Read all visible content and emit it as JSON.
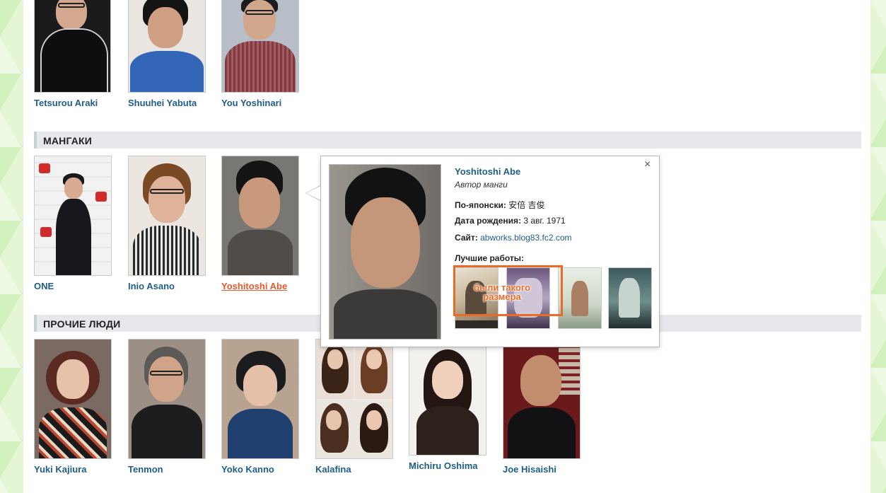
{
  "sections": {
    "mangaka_header": "МАНГАКИ",
    "others_header": "ПРОЧИЕ ЛЮДИ"
  },
  "top_people": [
    {
      "name": "Tetsurou Araki"
    },
    {
      "name": "Shuuhei Yabuta"
    },
    {
      "name": "You Yoshinari"
    }
  ],
  "mangaka": [
    {
      "name": "ONE"
    },
    {
      "name": "Inio Asano"
    },
    {
      "name": "Yoshitoshi Abe"
    }
  ],
  "others": [
    {
      "name": "Yuki Kajiura"
    },
    {
      "name": "Tenmon"
    },
    {
      "name": "Yoko Kanno"
    },
    {
      "name": "Kalafina"
    },
    {
      "name": "Michiru Oshima"
    },
    {
      "name": "Joe Hisaishi"
    }
  ],
  "popup": {
    "name": "Yoshitoshi Abe",
    "role": "Автор манги",
    "japanese_label": "По-японски:",
    "japanese_value": "安倍 吉俊",
    "birth_label": "Дата рождения:",
    "birth_value": "3 авг. 1971",
    "site_label": "Сайт:",
    "site_value": "abworks.blog83.fc2.com",
    "works_label": "Лучшие работы:",
    "close": "×"
  },
  "annotation": {
    "line1": "были такого",
    "line2": "размера",
    "color": "#ea6a26"
  },
  "colors": {
    "link": "#1f5d8a",
    "active_link": "#e8572b",
    "section_bg": "#e6e8ec"
  }
}
